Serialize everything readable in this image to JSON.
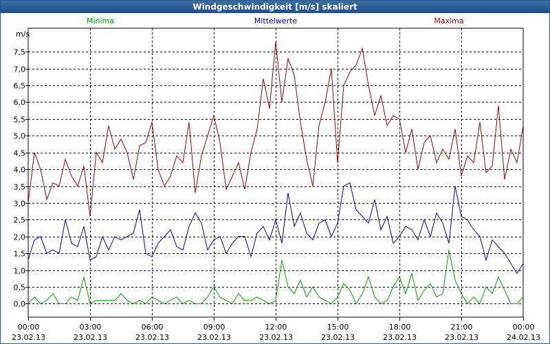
{
  "window": {
    "title": "Windgeschwindigkeit [m/s] skaliert"
  },
  "legend": {
    "min_label": "Minima",
    "mean_label": "Mittelwerte",
    "max_label": "Maxima"
  },
  "colors": {
    "min": "#00a000",
    "mean": "#0000b0",
    "max": "#a00000",
    "grid": "#000000",
    "title_bg": "#2b5a8a"
  },
  "chart_data": {
    "type": "line",
    "ylabel": "m/s",
    "ylim": [
      -0.4,
      8.2
    ],
    "yticks": [
      0.0,
      0.5,
      1.0,
      1.5,
      2.0,
      2.5,
      3.0,
      3.5,
      4.0,
      4.5,
      5.0,
      5.5,
      6.0,
      6.5,
      7.0,
      7.5
    ],
    "ytick_labels": [
      "0,0",
      "0,5",
      "1,0",
      "1,5",
      "2,0",
      "2,5",
      "3,0",
      "3,5",
      "4,0",
      "4,5",
      "5,0",
      "5,5",
      "6,0",
      "6,5",
      "7,0",
      "7,5"
    ],
    "xlim": [
      0,
      24
    ],
    "xticks": [
      0,
      3,
      6,
      9,
      12,
      15,
      18,
      21,
      24
    ],
    "xtick_labels": [
      {
        "time": "00:00",
        "date": "23.02.13"
      },
      {
        "time": "03:00",
        "date": "23.02.13"
      },
      {
        "time": "06:00",
        "date": "23.02.13"
      },
      {
        "time": "09:00",
        "date": "23.02.13"
      },
      {
        "time": "12:00",
        "date": "23.02.13"
      },
      {
        "time": "15:00",
        "date": "23.02.13"
      },
      {
        "time": "18:00",
        "date": "23.02.13"
      },
      {
        "time": "21:00",
        "date": "23.02.13"
      },
      {
        "time": "00:00",
        "date": "24.02.13"
      }
    ],
    "x": [
      0.0,
      0.3,
      0.6,
      0.9,
      1.2,
      1.5,
      1.8,
      2.1,
      2.4,
      2.7,
      3.0,
      3.3,
      3.6,
      3.9,
      4.2,
      4.5,
      4.8,
      5.1,
      5.4,
      5.7,
      6.0,
      6.3,
      6.6,
      6.9,
      7.2,
      7.5,
      7.8,
      8.1,
      8.4,
      8.7,
      9.0,
      9.3,
      9.6,
      9.9,
      10.2,
      10.5,
      10.8,
      11.1,
      11.4,
      11.7,
      12.0,
      12.3,
      12.6,
      12.9,
      13.2,
      13.5,
      13.8,
      14.1,
      14.4,
      14.7,
      15.0,
      15.3,
      15.6,
      15.9,
      16.2,
      16.5,
      16.8,
      17.1,
      17.4,
      17.7,
      18.0,
      18.3,
      18.6,
      18.9,
      19.2,
      19.5,
      19.8,
      20.1,
      20.4,
      20.7,
      21.0,
      21.3,
      21.6,
      21.9,
      22.2,
      22.5,
      22.8,
      23.1,
      23.4,
      23.7,
      24.0
    ],
    "series": [
      {
        "name": "Maxima",
        "color": "#a00000",
        "values": [
          3.0,
          4.5,
          4.0,
          3.1,
          3.6,
          3.5,
          4.3,
          3.8,
          3.5,
          4.1,
          2.6,
          4.5,
          4.2,
          5.3,
          4.6,
          4.9,
          4.5,
          3.7,
          4.7,
          4.8,
          5.4,
          4.0,
          3.5,
          3.8,
          4.4,
          4.2,
          5.4,
          3.3,
          4.4,
          5.0,
          5.6,
          4.8,
          3.4,
          3.8,
          4.2,
          3.4,
          4.5,
          5.2,
          6.7,
          5.8,
          7.8,
          6.0,
          7.3,
          6.8,
          5.4,
          4.3,
          3.5,
          5.3,
          6.0,
          7.0,
          4.2,
          6.5,
          6.9,
          7.1,
          7.6,
          6.5,
          5.6,
          6.2,
          5.3,
          5.6,
          5.5,
          4.5,
          5.2,
          4.0,
          4.8,
          5.0,
          4.2,
          4.6,
          4.3,
          5.2,
          3.8,
          4.4,
          4.2,
          5.4,
          3.9,
          4.1,
          5.9,
          3.7,
          4.6,
          4.2,
          5.3
        ]
      },
      {
        "name": "Mittelwerte",
        "color": "#0000b0",
        "values": [
          1.3,
          1.9,
          2.0,
          1.5,
          1.6,
          1.5,
          2.5,
          1.8,
          1.7,
          2.3,
          1.3,
          1.4,
          2.0,
          1.6,
          2.0,
          1.9,
          2.0,
          2.1,
          2.8,
          1.5,
          1.4,
          1.8,
          2.0,
          2.2,
          1.7,
          1.6,
          2.3,
          2.7,
          2.4,
          1.6,
          1.9,
          2.0,
          1.5,
          1.8,
          2.0,
          2.0,
          1.4,
          2.1,
          2.3,
          1.9,
          2.5,
          1.8,
          3.3,
          2.3,
          2.7,
          2.1,
          1.9,
          2.4,
          2.5,
          2.0,
          2.4,
          3.5,
          3.6,
          2.8,
          2.6,
          2.4,
          3.1,
          2.2,
          2.6,
          1.8,
          2.0,
          2.3,
          2.2,
          1.9,
          2.5,
          2.0,
          2.7,
          2.4,
          1.8,
          3.5,
          2.6,
          2.5,
          2.2,
          2.0,
          1.3,
          1.9,
          1.7,
          1.5,
          1.2,
          0.9,
          1.2
        ]
      },
      {
        "name": "Minima",
        "color": "#00a000",
        "values": [
          0.0,
          0.2,
          0.0,
          0.1,
          0.3,
          0.0,
          0.0,
          0.2,
          0.1,
          0.8,
          0.0,
          0.1,
          0.1,
          0.1,
          0.1,
          0.3,
          0.1,
          0.0,
          0.1,
          0.0,
          0.2,
          0.1,
          0.0,
          0.1,
          0.2,
          0.0,
          0.1,
          0.0,
          0.0,
          0.2,
          0.5,
          0.2,
          0.1,
          0.0,
          0.3,
          0.1,
          0.1,
          0.2,
          0.1,
          0.0,
          0.1,
          1.3,
          0.5,
          0.3,
          0.7,
          0.2,
          0.5,
          0.2,
          0.1,
          0.0,
          0.2,
          0.6,
          0.4,
          0.0,
          0.3,
          0.8,
          0.2,
          0.0,
          0.1,
          0.5,
          0.8,
          0.3,
          0.9,
          0.1,
          0.4,
          0.6,
          0.2,
          0.3,
          1.6,
          0.7,
          0.3,
          0.0,
          0.2,
          0.0,
          0.5,
          0.3,
          0.8,
          0.4,
          0.0,
          0.0,
          0.2
        ]
      }
    ]
  }
}
